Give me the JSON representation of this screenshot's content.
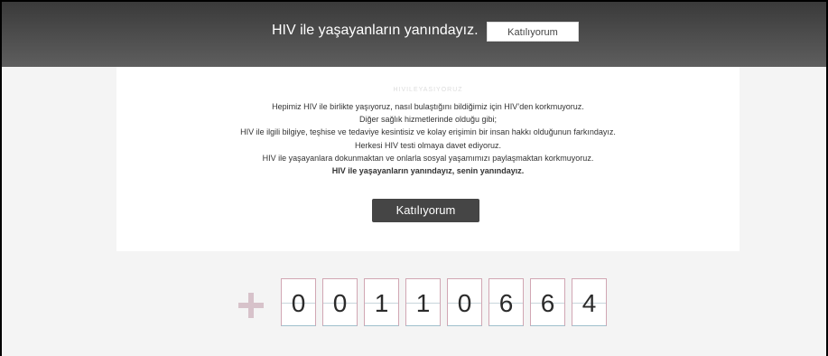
{
  "banner": {
    "text": "HIV ile yaşayanların yanındayız.",
    "button_label": "Katılıyorum"
  },
  "content": {
    "faint_text": "HIVILEYASIYORUZ",
    "lines": [
      "Hepimiz HIV ile birlikte yaşıyoruz, nasıl bulaştığını bildiğimiz için HIV’den korkmuyoruz.",
      "Diğer sağlık hizmetlerinde olduğu gibi;",
      "HIV ile ilgili bilgiye, teşhise ve tedaviye kesintisiz ve kolay erişimin bir insan hakkı olduğunun farkındayız.",
      "Herkesi HIV testi olmaya davet ediyoruz.",
      "HIV ile yaşayanlara dokunmaktan ve onlarla sosyal yaşamımızı paylaşmaktan korkmuyoruz."
    ],
    "bold_line": "HIV ile yaşayanların yanındayız, senin yanındayız.",
    "button_label": "Katılıyorum"
  },
  "counter": {
    "digits": [
      "0",
      "0",
      "1",
      "1",
      "0",
      "6",
      "6",
      "4"
    ],
    "plus_icon": "plus-icon",
    "colors": {
      "top_border": "#d1a6b3",
      "bottom_border": "#9fc0cc",
      "plus": "#d7c2ca"
    }
  },
  "colors": {
    "banner_bg": "#4a4a4a",
    "button_dark": "#454545",
    "page_bg": "#f4f4f4"
  }
}
